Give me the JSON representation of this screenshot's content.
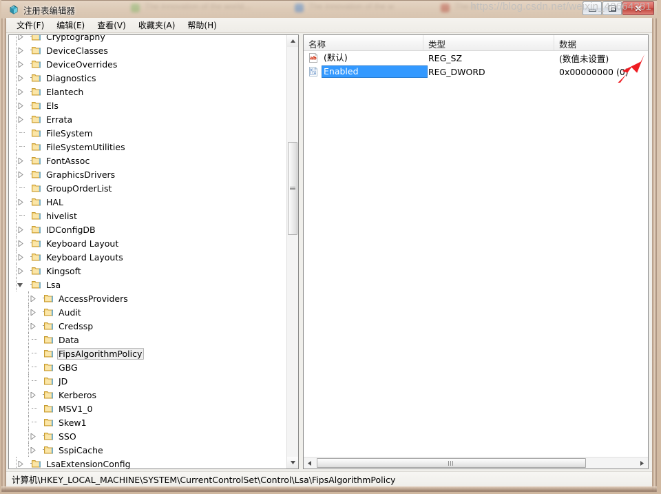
{
  "window": {
    "title": "注册表编辑器",
    "icon": "registry-editor-icon",
    "minimize_label": "最小化",
    "maximize_label": "最大化",
    "close_label": "关闭",
    "close_glyph": "✕"
  },
  "background": {
    "blur_text_1": "The innovation of the world...",
    "blur_text_2": "The innovation of the w",
    "blur_text_3": "The in"
  },
  "menubar": {
    "items": [
      {
        "label": "文件(F)",
        "name": "menu-file"
      },
      {
        "label": "编辑(E)",
        "name": "menu-edit"
      },
      {
        "label": "查看(V)",
        "name": "menu-view"
      },
      {
        "label": "收藏夹(A)",
        "name": "menu-favorites"
      },
      {
        "label": "帮助(H)",
        "name": "menu-help"
      }
    ]
  },
  "tree": {
    "selected_key": "FipsAlgorithmPolicy",
    "items": [
      {
        "label": "Cryptography",
        "indent": 0,
        "state": "collapsed",
        "clipped_top": true
      },
      {
        "label": "DeviceClasses",
        "indent": 0,
        "state": "collapsed"
      },
      {
        "label": "DeviceOverrides",
        "indent": 0,
        "state": "collapsed"
      },
      {
        "label": "Diagnostics",
        "indent": 0,
        "state": "collapsed"
      },
      {
        "label": "Elantech",
        "indent": 0,
        "state": "collapsed"
      },
      {
        "label": "Els",
        "indent": 0,
        "state": "collapsed"
      },
      {
        "label": "Errata",
        "indent": 0,
        "state": "collapsed"
      },
      {
        "label": "FileSystem",
        "indent": 0,
        "state": "leaf"
      },
      {
        "label": "FileSystemUtilities",
        "indent": 0,
        "state": "leaf"
      },
      {
        "label": "FontAssoc",
        "indent": 0,
        "state": "collapsed"
      },
      {
        "label": "GraphicsDrivers",
        "indent": 0,
        "state": "collapsed"
      },
      {
        "label": "GroupOrderList",
        "indent": 0,
        "state": "leaf"
      },
      {
        "label": "HAL",
        "indent": 0,
        "state": "collapsed"
      },
      {
        "label": "hivelist",
        "indent": 0,
        "state": "leaf"
      },
      {
        "label": "IDConfigDB",
        "indent": 0,
        "state": "collapsed"
      },
      {
        "label": "Keyboard Layout",
        "indent": 0,
        "state": "collapsed"
      },
      {
        "label": "Keyboard Layouts",
        "indent": 0,
        "state": "collapsed"
      },
      {
        "label": "Kingsoft",
        "indent": 0,
        "state": "collapsed"
      },
      {
        "label": "Lsa",
        "indent": 0,
        "state": "expanded"
      },
      {
        "label": "AccessProviders",
        "indent": 1,
        "state": "collapsed"
      },
      {
        "label": "Audit",
        "indent": 1,
        "state": "collapsed"
      },
      {
        "label": "Credssp",
        "indent": 1,
        "state": "collapsed"
      },
      {
        "label": "Data",
        "indent": 1,
        "state": "leaf"
      },
      {
        "label": "FipsAlgorithmPolicy",
        "indent": 1,
        "state": "leaf",
        "selected": true
      },
      {
        "label": "GBG",
        "indent": 1,
        "state": "leaf"
      },
      {
        "label": "JD",
        "indent": 1,
        "state": "leaf"
      },
      {
        "label": "Kerberos",
        "indent": 1,
        "state": "collapsed"
      },
      {
        "label": "MSV1_0",
        "indent": 1,
        "state": "leaf"
      },
      {
        "label": "Skew1",
        "indent": 1,
        "state": "leaf"
      },
      {
        "label": "SSO",
        "indent": 1,
        "state": "collapsed"
      },
      {
        "label": "SspiCache",
        "indent": 1,
        "state": "collapsed"
      },
      {
        "label": "LsaExtensionConfig",
        "indent": 0,
        "state": "collapsed",
        "clipped_bottom": true
      }
    ]
  },
  "values": {
    "columns": [
      "名称",
      "类型",
      "数据"
    ],
    "rows": [
      {
        "name": "(默认)",
        "type": "REG_SZ",
        "data": "(数值未设置)",
        "icon": "string-value-icon",
        "selected": false
      },
      {
        "name": "Enabled",
        "type": "REG_DWORD",
        "data": "0x00000000 (0)",
        "icon": "binary-value-icon",
        "selected": true
      }
    ]
  },
  "statusbar": {
    "path": "计算机\\HKEY_LOCAL_MACHINE\\SYSTEM\\CurrentControlSet\\Control\\Lsa\\FipsAlgorithmPolicy",
    "watermark": "https://blog.csdn.net/weixin_40664381"
  },
  "colors": {
    "selection_blue": "#3399ff",
    "annotation_red": "#ee1c22",
    "folder_yellow": "#f6d67a",
    "frame_tan": "#cfb79f"
  }
}
